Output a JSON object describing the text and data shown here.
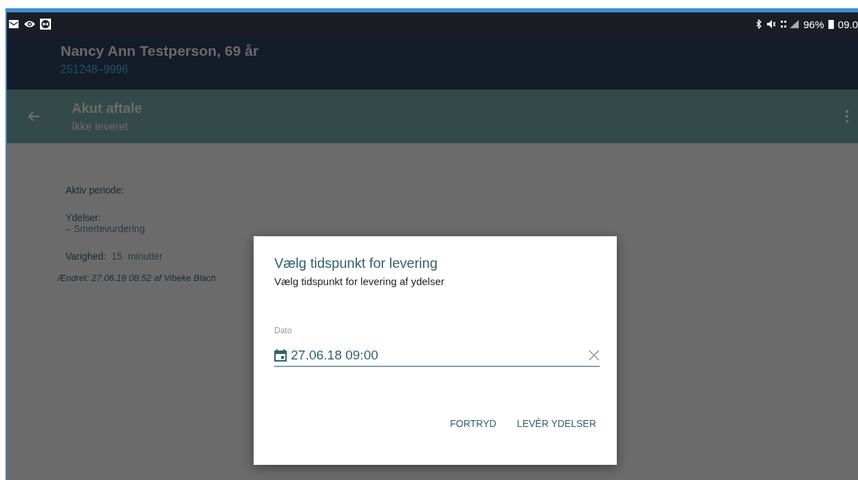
{
  "status_bar": {
    "battery": "96%",
    "time": "09.0"
  },
  "patient": {
    "name": "Nancy Ann Testperson, 69 år",
    "cpr": "251248–9996"
  },
  "toolbar": {
    "title": "Akut aftale",
    "subtitle": "Ikke leveret"
  },
  "details": {
    "period_label": "Aktiv periode:",
    "services_label": "Ydelser:",
    "services": [
      "– Smertevurdering"
    ],
    "duration_label": "Varighed:",
    "duration_value": "15",
    "duration_unit": "minutter",
    "changed": "Ændret: 27.06.18 08:52 af Vibeke Blach"
  },
  "dialog": {
    "title": "Vælg tidspunkt for levering",
    "subtitle": "Vælg tidspunkt for levering af ydelser",
    "field_label": "Dato",
    "field_value": "27.06.18 09:00",
    "buttons": [
      "FORTRYD",
      "LEVÉR YDELSER"
    ]
  }
}
